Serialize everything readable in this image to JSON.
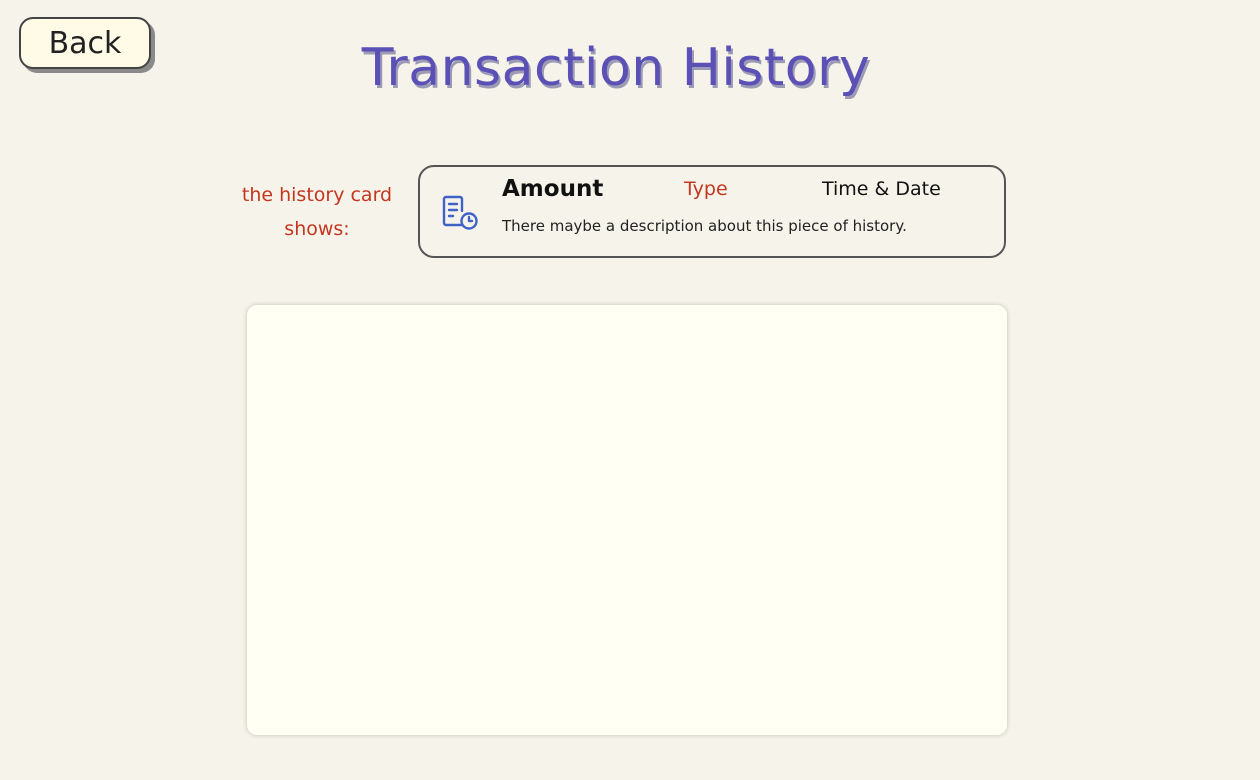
{
  "header": {
    "back_label": "Back",
    "title": "Transaction History"
  },
  "legend": {
    "label": "the history card shows:"
  },
  "sample_card": {
    "icon": "receipt-clock-icon",
    "amount_label": "Amount",
    "type_label": "Type",
    "datetime_label": "Time & Date",
    "description": "There maybe a description about this piece of history."
  },
  "colors": {
    "background": "#f6f4ea",
    "title": "#5a50b5",
    "accent_red": "#c5361f",
    "icon_blue": "#3f62c9",
    "list_background": "#fffff4"
  },
  "history_list": {
    "items": []
  }
}
